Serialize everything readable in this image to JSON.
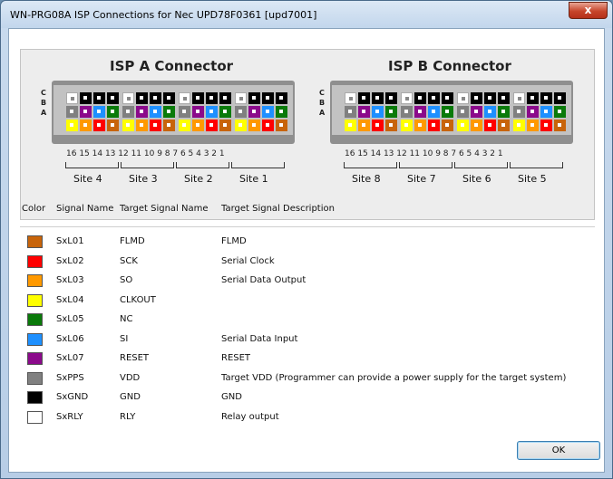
{
  "window": {
    "title": "WN-PRG08A ISP Connections for Nec UPD78F0361 [upd7001]",
    "close_label": "x"
  },
  "connectors": [
    {
      "title": "ISP A Connector",
      "pin_numbers": "16 15 14 13 12 11 10  9  8   7  6  5  4   3  2  1",
      "sites": [
        "Site 4",
        "Site 3",
        "Site 2",
        "Site 1"
      ]
    },
    {
      "title": "ISP B Connector",
      "pin_numbers": "16 15 14 13 12 11 10  9  8   7  6  5  4   3  2  1",
      "sites": [
        "Site 8",
        "Site 7",
        "Site 6",
        "Site 5"
      ]
    }
  ],
  "row_letters": [
    "C",
    "B",
    "A"
  ],
  "pin_rows": {
    "C": [
      "white",
      "black",
      "black",
      "black",
      "white",
      "black",
      "black",
      "black",
      "white",
      "black",
      "black",
      "black",
      "white",
      "black",
      "black",
      "black"
    ],
    "B": [
      "gray",
      "purple",
      "blue",
      "green",
      "gray",
      "purple",
      "blue",
      "green",
      "gray",
      "purple",
      "blue",
      "green",
      "gray",
      "purple",
      "blue",
      "green"
    ],
    "A": [
      "yellow",
      "orange",
      "red",
      "brown",
      "yellow",
      "orange",
      "red",
      "brown",
      "yellow",
      "orange",
      "red",
      "brown",
      "yellow",
      "orange",
      "red",
      "brown"
    ]
  },
  "colors": {
    "white": "#ffffff",
    "black": "#000000",
    "gray": "#808080",
    "purple": "#8b0a8b",
    "blue": "#1e90ff",
    "green": "#0a7a0a",
    "yellow": "#ffff00",
    "orange": "#ff9900",
    "red": "#ff0000",
    "brown": "#c8640a"
  },
  "table": {
    "headers": [
      "Color",
      "Signal Name",
      "Target Signal Name",
      "Target Signal Description"
    ],
    "rows": [
      {
        "color": "brown",
        "signal": "SxL01",
        "target": "FLMD",
        "description": "FLMD"
      },
      {
        "color": "red",
        "signal": "SxL02",
        "target": "SCK",
        "description": "Serial Clock"
      },
      {
        "color": "orange",
        "signal": "SxL03",
        "target": "SO",
        "description": "Serial Data Output"
      },
      {
        "color": "yellow",
        "signal": "SxL04",
        "target": "CLKOUT",
        "description": ""
      },
      {
        "color": "green",
        "signal": "SxL05",
        "target": "NC",
        "description": ""
      },
      {
        "color": "blue",
        "signal": "SxL06",
        "target": "SI",
        "description": "Serial Data Input"
      },
      {
        "color": "purple",
        "signal": "SxL07",
        "target": "RESET",
        "description": "RESET"
      },
      {
        "color": "gray",
        "signal": "SxPPS",
        "target": "VDD",
        "description": "Target VDD (Programmer can provide a power supply for the target system)"
      },
      {
        "color": "black",
        "signal": "SxGND",
        "target": "GND",
        "description": "GND"
      },
      {
        "color": "white",
        "signal": "SxRLY",
        "target": "RLY",
        "description": "Relay output"
      }
    ]
  },
  "buttons": {
    "ok_label": "OK"
  }
}
